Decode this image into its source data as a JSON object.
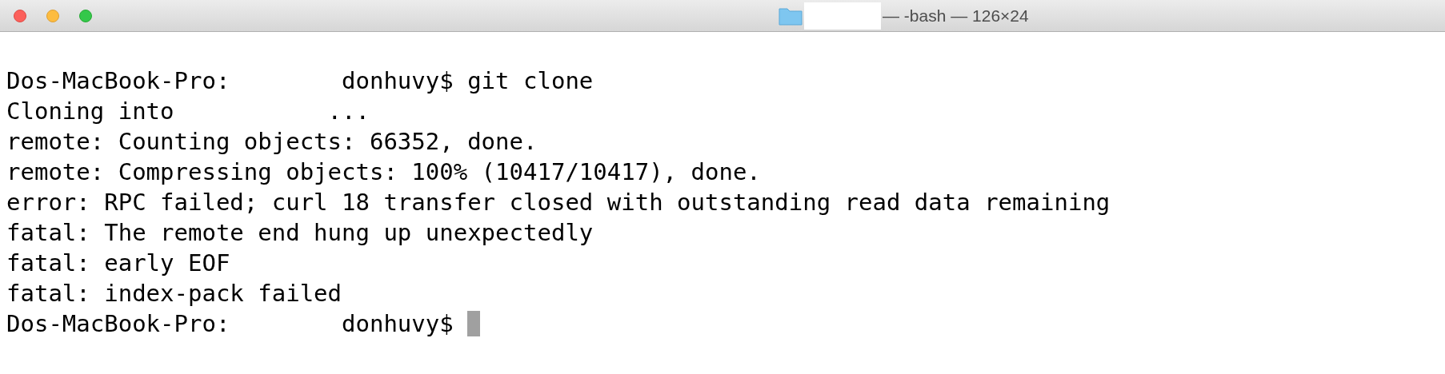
{
  "window": {
    "title": "— -bash — 126×24"
  },
  "terminal": {
    "lines": [
      "Dos-MacBook-Pro:        donhuvy$ git clone",
      "Cloning into           ...",
      "remote: Counting objects: 66352, done.",
      "remote: Compressing objects: 100% (10417/10417), done.",
      "error: RPC failed; curl 18 transfer closed with outstanding read data remaining",
      "fatal: The remote end hung up unexpectedly",
      "fatal: early EOF",
      "fatal: index-pack failed",
      "Dos-MacBook-Pro:        donhuvy$"
    ]
  }
}
